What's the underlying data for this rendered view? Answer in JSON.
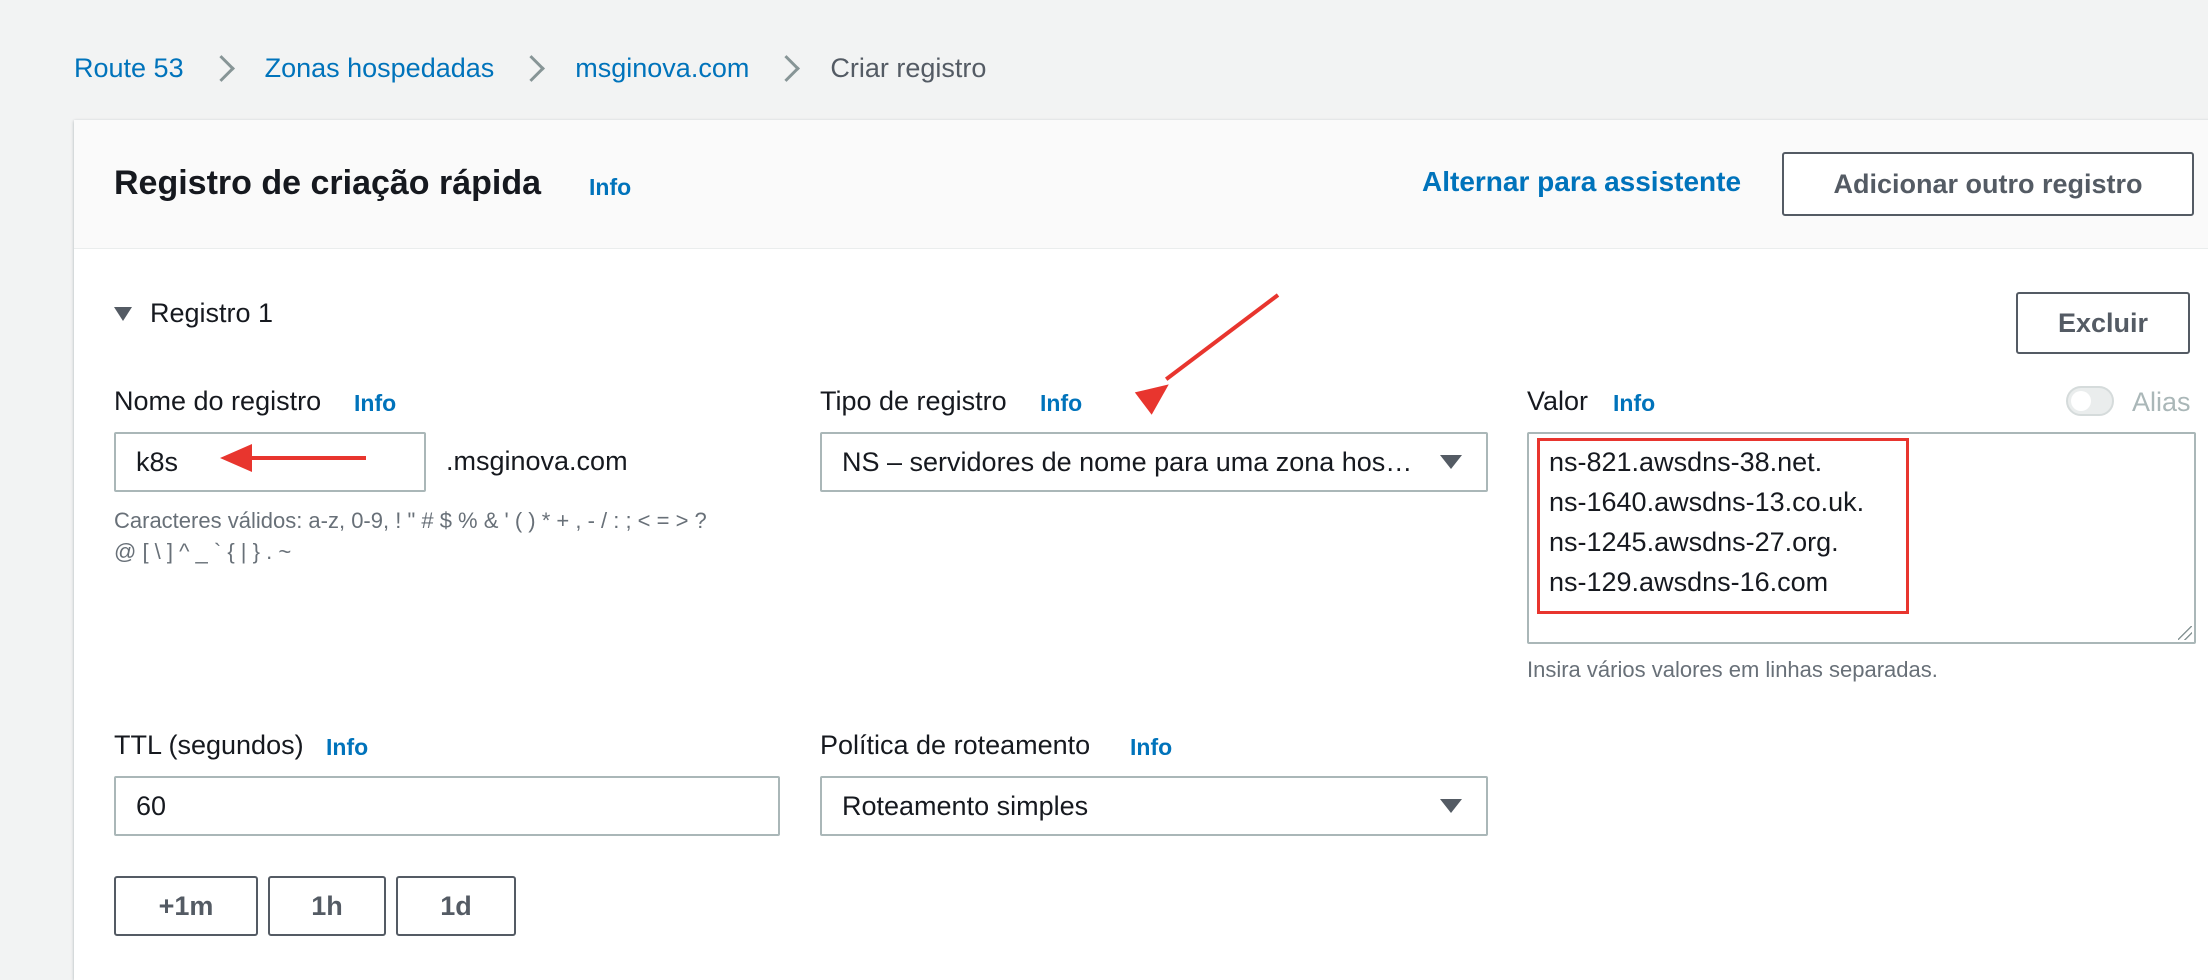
{
  "breadcrumb": {
    "items": [
      "Route 53",
      "Zonas hospedadas",
      "msginova.com"
    ],
    "current": "Criar registro"
  },
  "panel": {
    "title": "Registro de criação rápida",
    "info": "Info",
    "switch_link": "Alternar para assistente",
    "add_button": "Adicionar outro registro"
  },
  "record": {
    "section_label": "Registro 1",
    "delete_button": "Excluir",
    "name": {
      "label": "Nome do registro",
      "info": "Info",
      "value": "k8s",
      "suffix": ".msginova.com",
      "hint_line1": "Caracteres válidos: a-z, 0-9, ! \" # $ % & ' ( ) * + , - / : ; < = > ?",
      "hint_line2": "@ [ \\ ] ^ _ ` { | } . ~"
    },
    "type": {
      "label": "Tipo de registro",
      "info": "Info",
      "value": "NS – servidores de nome para uma zona hos…"
    },
    "value": {
      "label": "Valor",
      "info": "Info",
      "alias_label": "Alias",
      "lines": [
        "ns-821.awsdns-38.net.",
        "ns-1640.awsdns-13.co.uk.",
        "ns-1245.awsdns-27.org.",
        "ns-129.awsdns-16.com"
      ],
      "hint": "Insira vários valores em linhas separadas."
    },
    "ttl": {
      "label": "TTL (segundos)",
      "info": "Info",
      "value": "60",
      "buttons": [
        "+1m",
        "1h",
        "1d"
      ]
    },
    "routing": {
      "label": "Política de roteamento",
      "info": "Info",
      "value": "Roteamento simples"
    }
  },
  "colors": {
    "link": "#0073bb",
    "annotation": "#e8352e",
    "background": "#f2f3f3"
  }
}
